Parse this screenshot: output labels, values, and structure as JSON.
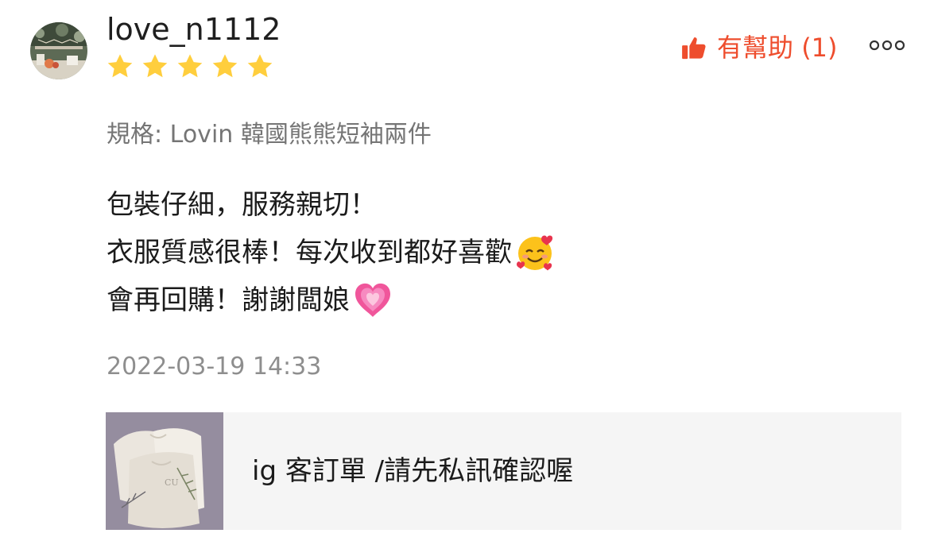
{
  "review": {
    "username": "love_n1112",
    "rating": 5,
    "rating_max": 5,
    "helpful_label": "有幫助",
    "helpful_count": "(1)",
    "more_label": "ooo",
    "variation": "規格: Lovin 韓國熊熊短袖兩件",
    "content_lines": [
      "包裝仔細，服務親切！",
      "衣服質感很棒！每次收到都好喜歡",
      "會再回購！謝謝闆娘"
    ],
    "line_emojis": [
      "",
      "smiling-face-with-hearts-icon",
      "growing-heart-icon"
    ],
    "timestamp": "2022-03-19 14:33",
    "thumb_icon": "thumbs-up-icon",
    "star_icon": "star-icon"
  },
  "product": {
    "name": "ig 客訂單 /請先私訊確認喔",
    "thumbnail_text": "CU"
  },
  "colors": {
    "accent": "#ee4d2d",
    "star": "#ffce3d",
    "muted": "#757575",
    "timestamp": "#8e8e8e",
    "card_bg": "#f5f5f5",
    "heart": "#f0569b"
  }
}
